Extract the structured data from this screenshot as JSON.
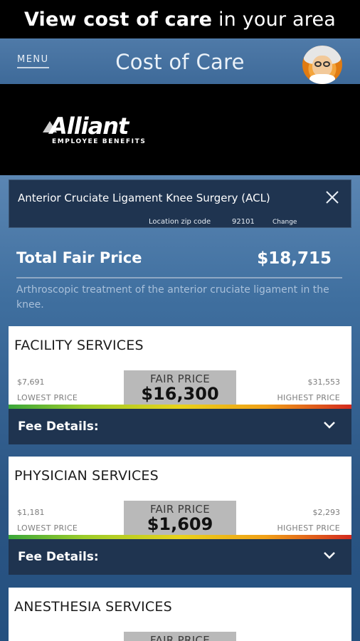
{
  "promo": {
    "bold": "View cost of care",
    "rest": " in your area"
  },
  "appbar": {
    "menu_label": "MENU",
    "title": "Cost of Care"
  },
  "logo": {
    "wordmark": "Alliant",
    "subtitle": "EMPLOYEE BENEFITS"
  },
  "procedure": {
    "name": "Anterior Cruciate Ligament Knee Surgery (ACL)",
    "zip_label": "Location zip code",
    "zip_value": "92101",
    "change_label": "Change"
  },
  "total": {
    "label": "Total Fair Price",
    "value": "$18,715",
    "description": "Arthroscopic treatment of the anterior cruciate ligament in the knee."
  },
  "cards": [
    {
      "title": "FACILITY SERVICES",
      "low_value": "$7,691",
      "low_label": "LOWEST PRICE",
      "fair_label": "FAIR PRICE",
      "fair_value": "$16,300",
      "high_value": "$31,553",
      "high_label": "HIGHEST PRICE",
      "fee_label": "Fee Details:"
    },
    {
      "title": "PHYSICIAN SERVICES",
      "low_value": "$1,181",
      "low_label": "LOWEST PRICE",
      "fair_label": "FAIR PRICE",
      "fair_value": "$1,609",
      "high_value": "$2,293",
      "high_label": "HIGHEST PRICE",
      "fee_label": "Fee Details:"
    },
    {
      "title": "ANESTHESIA SERVICES",
      "fair_label": "FAIR PRICE"
    }
  ],
  "icons": {
    "close": "close-icon",
    "chevron": "chevron-down-icon",
    "avatar": "doctor-avatar-icon"
  },
  "colors": {
    "header_bg": "#000000",
    "appbar": "#4a76a5",
    "panel_dark": "#1f3450",
    "fair_box": "#b9b9b9"
  }
}
